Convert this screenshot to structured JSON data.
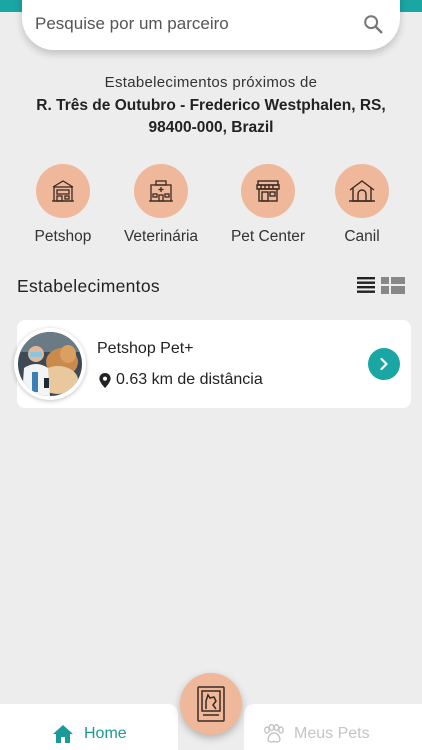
{
  "search": {
    "placeholder": "Pesquise por um parceiro"
  },
  "location": {
    "label": "Estabelecimentos próximos de",
    "address_line1": "R. Três de Outubro - Frederico Westphalen, RS,",
    "address_line2": "98400-000, Brazil"
  },
  "categories": [
    {
      "label": "Petshop",
      "icon": "petshop-icon"
    },
    {
      "label": "Veterinária",
      "icon": "vet-clinic-icon"
    },
    {
      "label": "Pet Center",
      "icon": "store-icon"
    },
    {
      "label": "Canil",
      "icon": "doghouse-icon"
    }
  ],
  "section": {
    "title": "Estabelecimentos"
  },
  "establishments": [
    {
      "name": "Petshop Pet+",
      "distance": "0.63 km de distância"
    }
  ],
  "tabbar": {
    "home_label": "Home",
    "pets_label": "Meus Pets"
  },
  "colors": {
    "accent": "#1aa6a3",
    "peach": "#f0b89a",
    "background": "#ededed"
  }
}
